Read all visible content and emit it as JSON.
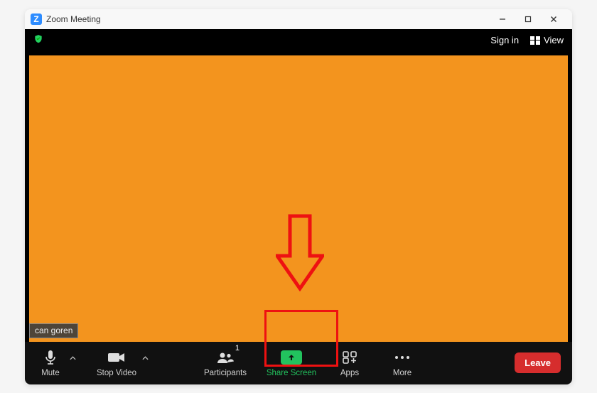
{
  "window": {
    "title": "Zoom Meeting"
  },
  "topbar": {
    "signin": "Sign in",
    "view": "View"
  },
  "participant_name": "can goren",
  "toolbar": {
    "mute": "Mute",
    "stop_video": "Stop Video",
    "participants": "Participants",
    "participants_count": "1",
    "share_screen": "Share Screen",
    "apps": "Apps",
    "more": "More",
    "leave": "Leave"
  },
  "colors": {
    "video_bg": "#f3941e",
    "accent_green": "#22c35e",
    "leave_red": "#d62d2d",
    "highlight_red": "#e11"
  }
}
